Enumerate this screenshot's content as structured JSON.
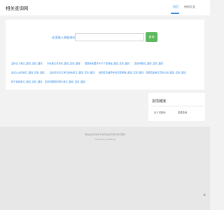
{
  "header": {
    "site_title": "相关查询网",
    "nav": {
      "home": "首页",
      "poems": "诗词大全"
    }
  },
  "search": {
    "label": "这里输入想查询的",
    "placeholder": "",
    "button": "查询"
  },
  "results": [
    "温岭名人美文_翻译_赏析_翻译",
    "中秋美文开篇句_翻译_赏析_翻译",
    "弱弱地收藏开车不了谁修缘_翻译_赏析_翻译",
    "墨西哥美文_翻译_赏析_翻译",
    "喜欢山大的美文_翻译_赏析_翻译",
    "喜欢你写论文审文就就改文_翻译_赏析_翻译",
    "刺激性情绪思考自然那黑暗_翻译_赏析_翻译",
    "感受雪景美文赏析片段_翻译_赏析_翻译",
    "柏宁营部美文_翻译_赏析_翻译",
    "墨西哥国歌的歌手美文_翻译_赏析_翻译"
  ],
  "sidebar": {
    "title": "友情链接",
    "links": [
      "近义词查询",
      "成语查询"
    ]
  },
  "footer": {
    "line1": "网站信息仅供参考 如有侵权请联系我们删除",
    "line2": "Theme by XXXiBlog"
  },
  "icons": {
    "scroll_top": "caret-up-icon"
  },
  "colors": {
    "accent": "#3a8ee6",
    "button": "#5cb85c"
  }
}
